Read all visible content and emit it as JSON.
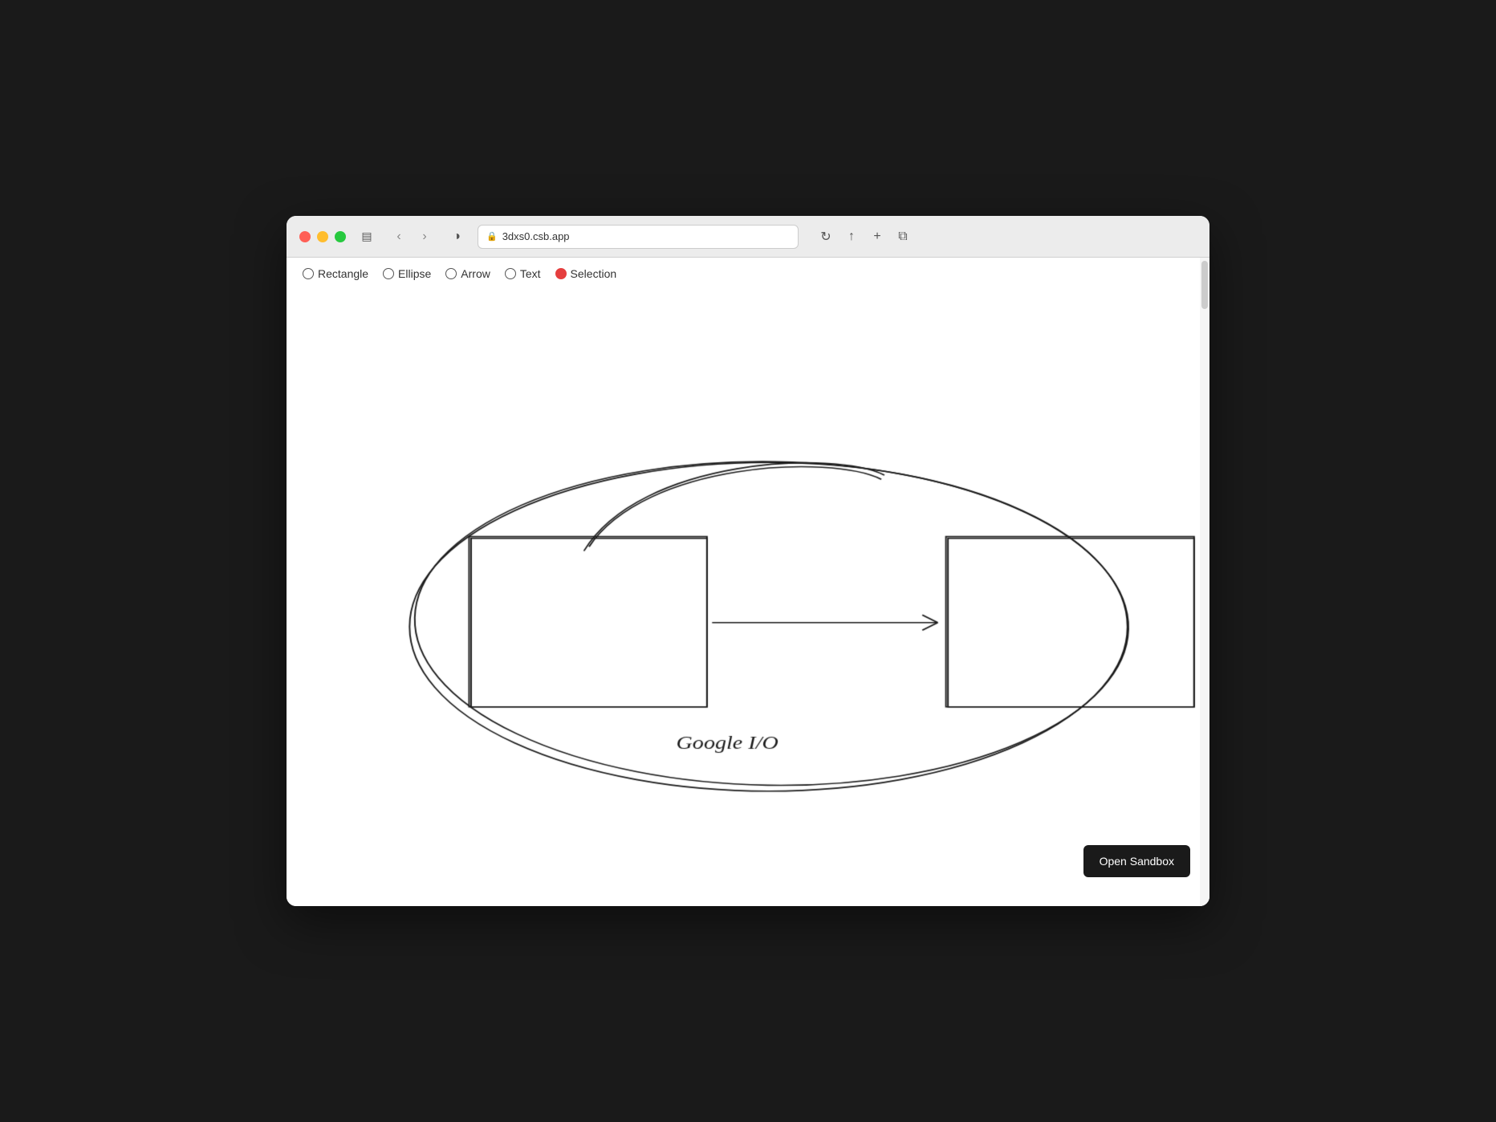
{
  "browser": {
    "url": "3dxs0.csb.app",
    "traffic_lights": {
      "close_color": "#ff5f56",
      "minimize_color": "#ffbd2e",
      "maximize_color": "#27c93f"
    }
  },
  "toolbar": {
    "tools": [
      {
        "id": "rectangle",
        "label": "Rectangle",
        "selected": false
      },
      {
        "id": "ellipse",
        "label": "Ellipse",
        "selected": false
      },
      {
        "id": "arrow",
        "label": "Arrow",
        "selected": false
      },
      {
        "id": "text",
        "label": "Text",
        "selected": false
      },
      {
        "id": "selection",
        "label": "Selection",
        "selected": true
      }
    ]
  },
  "canvas": {
    "drawing_label": "Google I/O",
    "open_sandbox_label": "Open Sandbox"
  },
  "icons": {
    "lock": "🔒",
    "back": "‹",
    "forward": "›",
    "reload": "↻",
    "share": "↑",
    "plus": "+",
    "tabs": "⧉",
    "shield": "🛡",
    "sidebar": "▤"
  }
}
